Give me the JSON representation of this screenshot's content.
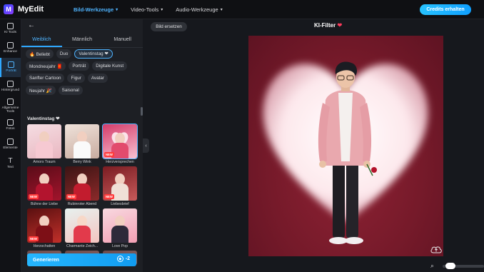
{
  "app": {
    "name": "MyEdit",
    "logo_letter": "M"
  },
  "topnav": [
    {
      "label": "Bild-Werkzeuge",
      "active": true
    },
    {
      "label": "Video-Tools",
      "active": false
    },
    {
      "label": "Audio-Werkzeuge",
      "active": false
    }
  ],
  "credits_button": "Credits erhalten",
  "rail": [
    {
      "label": "KI Tools",
      "icon": "sparkle-icon"
    },
    {
      "label": "Enhance",
      "icon": "enhance-icon"
    },
    {
      "label": "Porträt",
      "icon": "portrait-icon",
      "active": true
    },
    {
      "label": "Hintergrund",
      "icon": "background-icon"
    },
    {
      "label": "Allgemeine Tools",
      "icon": "tools-icon"
    },
    {
      "label": "Fotos",
      "icon": "photos-icon"
    },
    {
      "label": "Elemente",
      "icon": "elements-icon"
    },
    {
      "label": "Text",
      "icon": "text-icon"
    }
  ],
  "tabs": [
    "Weiblich",
    "Männlich",
    "Manuell"
  ],
  "chips": {
    "row1": [
      "🔥 Beliebt",
      "Duo",
      "Valentinstag ❤"
    ],
    "row2": [
      "Mondneujahr 🧧",
      "Porträt",
      "Digitale Kunst"
    ],
    "row3": [
      "Sanfter Cartoon",
      "Figur",
      "Avatar"
    ],
    "row4": [
      "Neujahr 🎉",
      "Saisonal"
    ]
  },
  "section_title": "Valentinstag ❤",
  "templates": [
    {
      "caption": "Amors Traum",
      "new": ""
    },
    {
      "caption": "Berry Wink",
      "new": ""
    },
    {
      "caption": "Herzversprechen",
      "new": "NEW"
    },
    {
      "caption": "Bühne der Liebe",
      "new": "NEW"
    },
    {
      "caption": "Rubinroter Abend",
      "new": "NEW"
    },
    {
      "caption": "Liebesbrief",
      "new": "NEW"
    },
    {
      "caption": "Herzschatten",
      "new": "NEW"
    },
    {
      "caption": "Charmante Zeich...",
      "new": ""
    },
    {
      "caption": "Love Pop",
      "new": ""
    }
  ],
  "generate": {
    "label": "Generieren",
    "cost": "-2"
  },
  "canvas": {
    "replace_button": "Bild ersetzen",
    "title": "KI-Filter",
    "title_icon": "❤"
  },
  "colors": {
    "accent": "#2fa8ff",
    "photo_bg": "#761a2a",
    "heart_glow": "#ffffff"
  }
}
